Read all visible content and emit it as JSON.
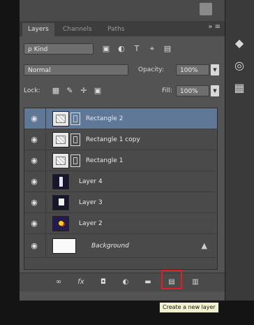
{
  "tabs": [
    {
      "label": "Layers",
      "active": true
    },
    {
      "label": "Channels",
      "active": false
    },
    {
      "label": "Paths",
      "active": false
    }
  ],
  "tab_menu": "» ≡",
  "filter": {
    "value": "ρ Kind",
    "icons": [
      "▣",
      "◐",
      "T",
      "⌖",
      "▤"
    ]
  },
  "blend": {
    "mode": "Normal",
    "opacity_label": "Opacity:",
    "opacity_value": "100%"
  },
  "lock": {
    "label": "Lock:",
    "icons": [
      "▦",
      "✎",
      "✛",
      "▣"
    ],
    "fill_label": "Fill:",
    "fill_value": "100%"
  },
  "layers": [
    {
      "name": "Rectangle 2",
      "thumb": "vector",
      "mask": true,
      "selected": true
    },
    {
      "name": "Rectangle 1 copy",
      "thumb": "vector",
      "mask": true,
      "selected": false
    },
    {
      "name": "Rectangle 1",
      "thumb": "vector",
      "mask": true,
      "selected": false
    },
    {
      "name": "Layer 4",
      "thumb": "dark",
      "mask": false,
      "selected": false
    },
    {
      "name": "Layer 3",
      "thumb": "l3",
      "mask": false,
      "selected": false
    },
    {
      "name": "Layer 2",
      "thumb": "l2",
      "mask": false,
      "selected": false
    },
    {
      "name": "Background",
      "thumb": "white",
      "mask": false,
      "selected": false,
      "locked": true
    }
  ],
  "bottom_icons": [
    "∞",
    "fx",
    "◘",
    "◐",
    "▬",
    "▤",
    "▥"
  ],
  "tooltip": "Create a new layer",
  "eye_glyph": "◉",
  "lock_glyph": "▲",
  "dock_icons": [
    "◆",
    "◎",
    "▦"
  ]
}
